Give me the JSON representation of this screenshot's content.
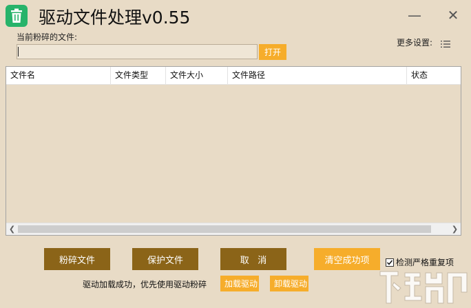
{
  "window": {
    "title": "驱动文件处理v0.55",
    "minimize_glyph": "—",
    "close_glyph": "✕",
    "icon": "trash-can-icon",
    "icon_color": "#27b36a"
  },
  "file_section": {
    "label": "当前粉碎的文件:",
    "input_value": "",
    "open_button": "打开"
  },
  "settings": {
    "label": "更多设置:",
    "icon": "list-icon"
  },
  "table": {
    "columns": [
      "文件名",
      "文件类型",
      "文件大小",
      "文件路径",
      "状态"
    ],
    "rows": []
  },
  "actions": {
    "shred_button": "粉碎文件",
    "protect_button": "保护文件",
    "cancel_button": "取   消",
    "clear_success_button": "清空成功项",
    "check_duplicates_label": "检测严格重复项",
    "check_duplicates_checked": true,
    "load_driver_button": "加载驱动",
    "unload_driver_button": "卸载驱动"
  },
  "status": {
    "message": "驱动加载成功，优先使用驱动粉碎"
  },
  "colors": {
    "background": "#e8dbc6",
    "accent_orange": "#f6ad2b",
    "accent_brown": "#8b6418"
  }
}
